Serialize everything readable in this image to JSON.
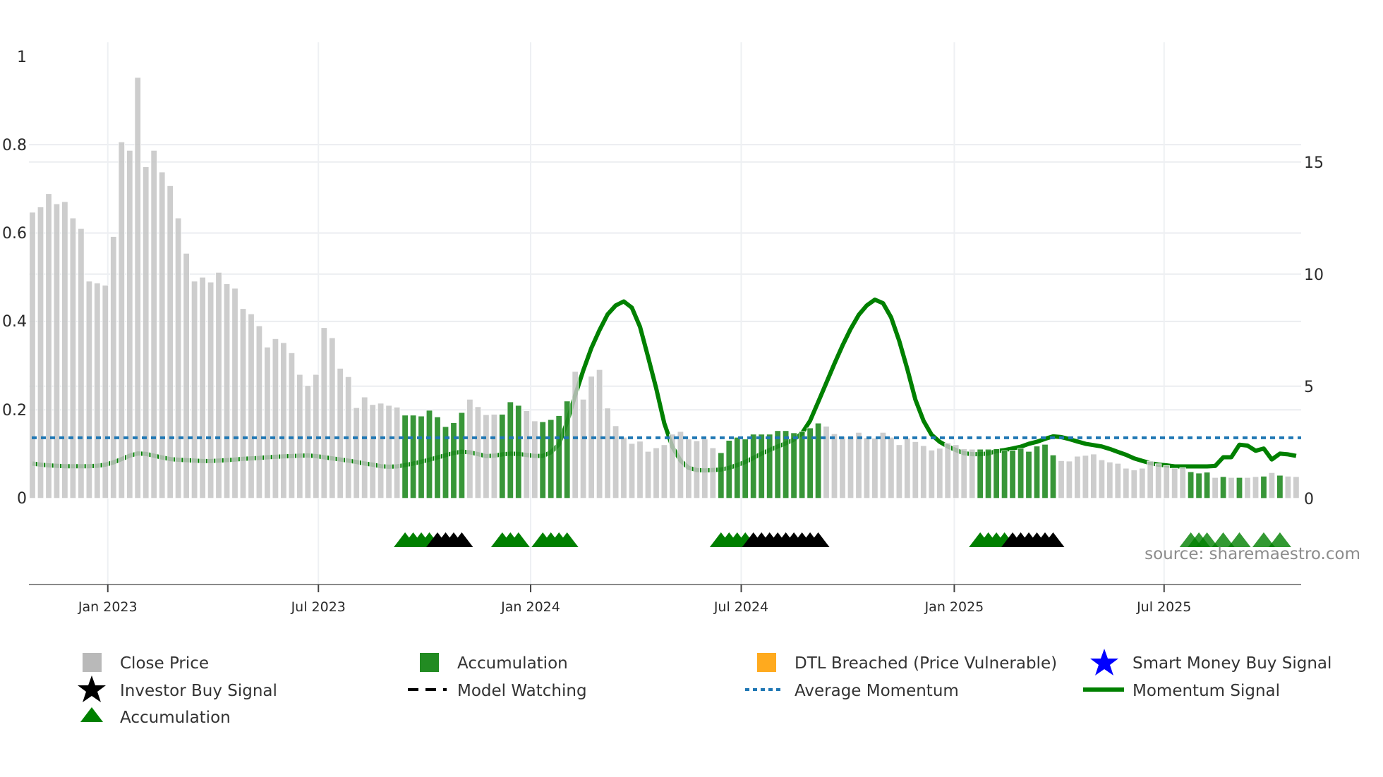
{
  "chart_data": {
    "type": "bar",
    "title": "",
    "xlabel": "",
    "ylabel": "",
    "x_unit": "week index (1 = first bar)",
    "x_ticks": [
      {
        "label": "Jan 2023",
        "week": 10.3
      },
      {
        "label": "Jul 2023",
        "week": 36.3
      },
      {
        "label": "Jan 2024",
        "week": 62.5
      },
      {
        "label": "Jul 2024",
        "week": 88.5
      },
      {
        "label": "Jan 2025",
        "week": 114.8
      },
      {
        "label": "Jul 2025",
        "week": 140.7
      }
    ],
    "y_left": {
      "range": [
        0,
        1
      ],
      "ticks": [
        "0",
        "0.2",
        "0.4",
        "0.6",
        "0.8",
        "1"
      ],
      "tick_values": [
        0,
        0.2,
        0.4,
        0.6,
        0.8,
        1
      ]
    },
    "y_right": {
      "range": [
        0,
        19.7
      ],
      "ticks": [
        "0",
        "5",
        "10",
        "15"
      ],
      "tick_values": [
        0,
        5,
        10,
        15
      ]
    },
    "grid": true,
    "legend_placement": "bottom",
    "close_price": [
      0.647,
      0.659,
      0.689,
      0.666,
      0.671,
      0.634,
      0.61,
      0.491,
      0.487,
      0.482,
      0.592,
      0.806,
      0.787,
      0.952,
      0.75,
      0.787,
      0.738,
      0.707,
      0.634,
      0.554,
      0.491,
      0.5,
      0.489,
      0.511,
      0.485,
      0.475,
      0.429,
      0.417,
      0.39,
      0.342,
      0.361,
      0.352,
      0.329,
      0.28,
      0.255,
      0.28,
      0.386,
      0.363,
      0.294,
      0.275,
      0.205,
      0.229,
      0.212,
      0.215,
      0.21,
      0.206,
      0.188,
      0.188,
      0.186,
      0.199,
      0.184,
      0.162,
      0.171,
      0.194,
      0.224,
      0.207,
      0.189,
      0.19,
      0.19,
      0.218,
      0.21,
      0.198,
      0.175,
      0.173,
      0.178,
      0.187,
      0.22,
      0.287,
      0.224,
      0.276,
      0.291,
      0.204,
      0.164,
      0.138,
      0.124,
      0.129,
      0.106,
      0.114,
      0.121,
      0.145,
      0.151,
      0.134,
      0.13,
      0.134,
      0.114,
      0.103,
      0.131,
      0.138,
      0.134,
      0.145,
      0.145,
      0.145,
      0.153,
      0.153,
      0.148,
      0.151,
      0.159,
      0.17,
      0.163,
      0.146,
      0.14,
      0.14,
      0.149,
      0.137,
      0.136,
      0.149,
      0.138,
      0.121,
      0.136,
      0.128,
      0.119,
      0.109,
      0.113,
      0.125,
      0.121,
      0.112,
      0.111,
      0.111,
      0.111,
      0.112,
      0.107,
      0.109,
      0.113,
      0.106,
      0.118,
      0.122,
      0.098,
      0.085,
      0.084,
      0.095,
      0.097,
      0.1,
      0.087,
      0.082,
      0.079,
      0.068,
      0.064,
      0.068,
      0.084,
      0.078,
      0.074,
      0.068,
      0.069,
      0.06,
      0.057,
      0.059,
      0.047,
      0.049,
      0.047,
      0.047,
      0.047,
      0.049,
      0.05,
      0.058,
      0.052,
      0.05,
      0.049
    ],
    "accumulation_weeks": [
      47,
      48,
      49,
      50,
      51,
      52,
      53,
      54,
      59,
      60,
      61,
      64,
      65,
      66,
      67,
      86,
      87,
      88,
      89,
      90,
      91,
      92,
      93,
      94,
      95,
      96,
      97,
      98,
      118,
      119,
      120,
      121,
      122,
      123,
      124,
      125,
      126,
      127,
      144,
      145,
      146,
      148,
      150,
      153,
      155
    ],
    "momentum_signal": [
      1.55,
      1.5,
      1.47,
      1.45,
      1.43,
      1.43,
      1.43,
      1.43,
      1.45,
      1.5,
      1.6,
      1.75,
      1.9,
      2.0,
      1.98,
      1.9,
      1.82,
      1.75,
      1.72,
      1.7,
      1.68,
      1.66,
      1.66,
      1.68,
      1.7,
      1.73,
      1.76,
      1.78,
      1.8,
      1.83,
      1.85,
      1.87,
      1.88,
      1.9,
      1.91,
      1.88,
      1.83,
      1.78,
      1.73,
      1.68,
      1.62,
      1.55,
      1.5,
      1.43,
      1.41,
      1.42,
      1.48,
      1.55,
      1.63,
      1.72,
      1.82,
      1.92,
      2.02,
      2.08,
      2.05,
      1.97,
      1.88,
      1.9,
      1.96,
      1.99,
      1.98,
      1.93,
      1.89,
      1.89,
      2.05,
      2.41,
      3.4,
      4.6,
      5.7,
      6.7,
      7.5,
      8.2,
      8.6,
      8.78,
      8.5,
      7.65,
      6.3,
      4.9,
      3.35,
      2.3,
      1.68,
      1.36,
      1.26,
      1.24,
      1.26,
      1.28,
      1.36,
      1.48,
      1.62,
      1.8,
      1.99,
      2.15,
      2.31,
      2.45,
      2.62,
      2.9,
      3.46,
      4.3,
      5.14,
      6.0,
      6.81,
      7.55,
      8.18,
      8.6,
      8.86,
      8.7,
      8.07,
      7.02,
      5.77,
      4.4,
      3.46,
      2.83,
      2.52,
      2.31,
      2.15,
      2.01,
      1.97,
      1.97,
      2.0,
      2.1,
      2.15,
      2.22,
      2.3,
      2.43,
      2.52,
      2.65,
      2.76,
      2.73,
      2.64,
      2.53,
      2.43,
      2.37,
      2.31,
      2.2,
      2.07,
      1.94,
      1.78,
      1.67,
      1.57,
      1.5,
      1.47,
      1.42,
      1.42,
      1.42,
      1.42,
      1.42,
      1.44,
      1.83,
      1.83,
      2.39,
      2.35,
      2.12,
      2.22,
      1.73,
      1.99,
      1.96,
      1.89
    ],
    "average_momentum": 2.7,
    "markers": {
      "accumulation_triangle_weeks": [
        47,
        48,
        49,
        50,
        59,
        60,
        61,
        64,
        65,
        66,
        67,
        86,
        87,
        88,
        89,
        118,
        119,
        120,
        121,
        144,
        145,
        146,
        148,
        150,
        153,
        155
      ],
      "black_triangle_weeks": [
        51,
        52,
        53,
        54,
        90,
        91,
        92,
        93,
        94,
        95,
        96,
        97,
        98,
        122,
        123,
        124,
        125,
        126,
        127
      ]
    },
    "legend": [
      {
        "label": "Close Price",
        "symbol": "square",
        "color": "#b9b9b9"
      },
      {
        "label": "Accumulation",
        "symbol": "square",
        "color": "#228b22"
      },
      {
        "label": "DTL Breached (Price Vulnerable)",
        "symbol": "square",
        "color": "#ffaa1e"
      },
      {
        "label": "Smart Money Buy Signal",
        "symbol": "star",
        "color": "#0000ff"
      },
      {
        "label": "Investor Buy Signal",
        "symbol": "star",
        "color": "#000000"
      },
      {
        "label": "Model Watching",
        "symbol": "dash",
        "color": "#000000"
      },
      {
        "label": "Average Momentum",
        "symbol": "dot",
        "color": "#1f77b4"
      },
      {
        "label": "Momentum Signal",
        "symbol": "line",
        "color": "#008000"
      },
      {
        "label": "Accumulation",
        "symbol": "triangle",
        "color": "#008000"
      }
    ],
    "source": "source: sharemaestro.com",
    "colors": {
      "price": "#c4c4c4",
      "accumulation": "#228b22",
      "momentum": "#008000",
      "average": "#1f77b4",
      "triangle_green": "#008000",
      "triangle_black": "#000000"
    }
  }
}
